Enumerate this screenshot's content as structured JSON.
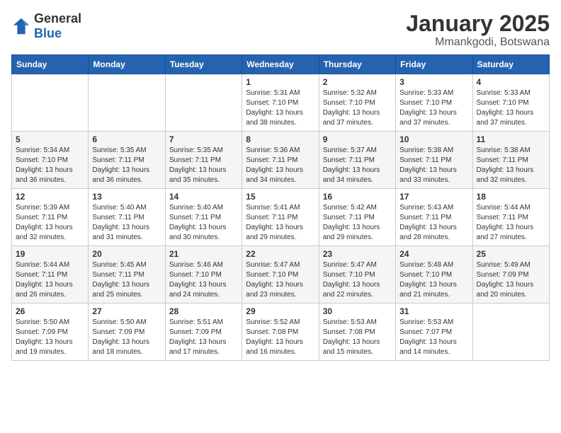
{
  "logo": {
    "general": "General",
    "blue": "Blue"
  },
  "header": {
    "month": "January 2025",
    "location": "Mmankgodi, Botswana"
  },
  "weekdays": [
    "Sunday",
    "Monday",
    "Tuesday",
    "Wednesday",
    "Thursday",
    "Friday",
    "Saturday"
  ],
  "weeks": [
    [
      {
        "day": "",
        "info": ""
      },
      {
        "day": "",
        "info": ""
      },
      {
        "day": "",
        "info": ""
      },
      {
        "day": "1",
        "info": "Sunrise: 5:31 AM\nSunset: 7:10 PM\nDaylight: 13 hours\nand 38 minutes."
      },
      {
        "day": "2",
        "info": "Sunrise: 5:32 AM\nSunset: 7:10 PM\nDaylight: 13 hours\nand 37 minutes."
      },
      {
        "day": "3",
        "info": "Sunrise: 5:33 AM\nSunset: 7:10 PM\nDaylight: 13 hours\nand 37 minutes."
      },
      {
        "day": "4",
        "info": "Sunrise: 5:33 AM\nSunset: 7:10 PM\nDaylight: 13 hours\nand 37 minutes."
      }
    ],
    [
      {
        "day": "5",
        "info": "Sunrise: 5:34 AM\nSunset: 7:10 PM\nDaylight: 13 hours\nand 36 minutes."
      },
      {
        "day": "6",
        "info": "Sunrise: 5:35 AM\nSunset: 7:11 PM\nDaylight: 13 hours\nand 36 minutes."
      },
      {
        "day": "7",
        "info": "Sunrise: 5:35 AM\nSunset: 7:11 PM\nDaylight: 13 hours\nand 35 minutes."
      },
      {
        "day": "8",
        "info": "Sunrise: 5:36 AM\nSunset: 7:11 PM\nDaylight: 13 hours\nand 34 minutes."
      },
      {
        "day": "9",
        "info": "Sunrise: 5:37 AM\nSunset: 7:11 PM\nDaylight: 13 hours\nand 34 minutes."
      },
      {
        "day": "10",
        "info": "Sunrise: 5:38 AM\nSunset: 7:11 PM\nDaylight: 13 hours\nand 33 minutes."
      },
      {
        "day": "11",
        "info": "Sunrise: 5:38 AM\nSunset: 7:11 PM\nDaylight: 13 hours\nand 32 minutes."
      }
    ],
    [
      {
        "day": "12",
        "info": "Sunrise: 5:39 AM\nSunset: 7:11 PM\nDaylight: 13 hours\nand 32 minutes."
      },
      {
        "day": "13",
        "info": "Sunrise: 5:40 AM\nSunset: 7:11 PM\nDaylight: 13 hours\nand 31 minutes."
      },
      {
        "day": "14",
        "info": "Sunrise: 5:40 AM\nSunset: 7:11 PM\nDaylight: 13 hours\nand 30 minutes."
      },
      {
        "day": "15",
        "info": "Sunrise: 5:41 AM\nSunset: 7:11 PM\nDaylight: 13 hours\nand 29 minutes."
      },
      {
        "day": "16",
        "info": "Sunrise: 5:42 AM\nSunset: 7:11 PM\nDaylight: 13 hours\nand 29 minutes."
      },
      {
        "day": "17",
        "info": "Sunrise: 5:43 AM\nSunset: 7:11 PM\nDaylight: 13 hours\nand 28 minutes."
      },
      {
        "day": "18",
        "info": "Sunrise: 5:44 AM\nSunset: 7:11 PM\nDaylight: 13 hours\nand 27 minutes."
      }
    ],
    [
      {
        "day": "19",
        "info": "Sunrise: 5:44 AM\nSunset: 7:11 PM\nDaylight: 13 hours\nand 26 minutes."
      },
      {
        "day": "20",
        "info": "Sunrise: 5:45 AM\nSunset: 7:11 PM\nDaylight: 13 hours\nand 25 minutes."
      },
      {
        "day": "21",
        "info": "Sunrise: 5:46 AM\nSunset: 7:10 PM\nDaylight: 13 hours\nand 24 minutes."
      },
      {
        "day": "22",
        "info": "Sunrise: 5:47 AM\nSunset: 7:10 PM\nDaylight: 13 hours\nand 23 minutes."
      },
      {
        "day": "23",
        "info": "Sunrise: 5:47 AM\nSunset: 7:10 PM\nDaylight: 13 hours\nand 22 minutes."
      },
      {
        "day": "24",
        "info": "Sunrise: 5:48 AM\nSunset: 7:10 PM\nDaylight: 13 hours\nand 21 minutes."
      },
      {
        "day": "25",
        "info": "Sunrise: 5:49 AM\nSunset: 7:09 PM\nDaylight: 13 hours\nand 20 minutes."
      }
    ],
    [
      {
        "day": "26",
        "info": "Sunrise: 5:50 AM\nSunset: 7:09 PM\nDaylight: 13 hours\nand 19 minutes."
      },
      {
        "day": "27",
        "info": "Sunrise: 5:50 AM\nSunset: 7:09 PM\nDaylight: 13 hours\nand 18 minutes."
      },
      {
        "day": "28",
        "info": "Sunrise: 5:51 AM\nSunset: 7:09 PM\nDaylight: 13 hours\nand 17 minutes."
      },
      {
        "day": "29",
        "info": "Sunrise: 5:52 AM\nSunset: 7:08 PM\nDaylight: 13 hours\nand 16 minutes."
      },
      {
        "day": "30",
        "info": "Sunrise: 5:53 AM\nSunset: 7:08 PM\nDaylight: 13 hours\nand 15 minutes."
      },
      {
        "day": "31",
        "info": "Sunrise: 5:53 AM\nSunset: 7:07 PM\nDaylight: 13 hours\nand 14 minutes."
      },
      {
        "day": "",
        "info": ""
      }
    ]
  ]
}
